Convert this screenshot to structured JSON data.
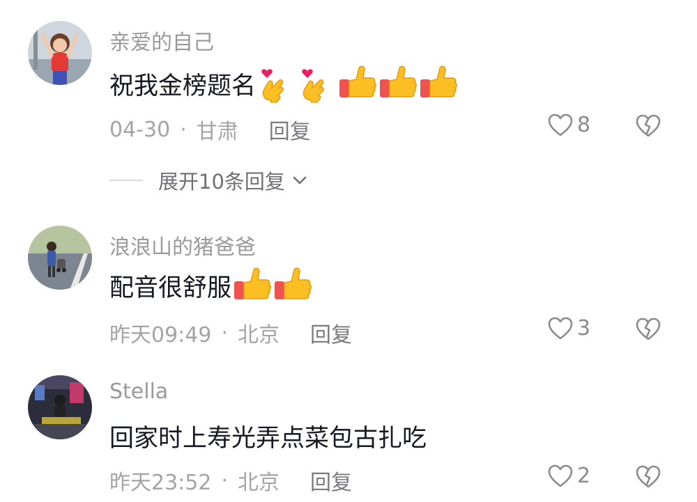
{
  "comments": [
    {
      "username": "亲爱的自己",
      "text": "祝我金榜题名",
      "emojis": [
        "finger-heart",
        "finger-heart",
        "thumbs-up",
        "thumbs-up",
        "thumbs-up"
      ],
      "date": "04-30",
      "separator": "·",
      "location": "甘肃",
      "reply_label": "回复",
      "likes": "8"
    },
    {
      "username": "浪浪山的猪爸爸",
      "text": "配音很舒服",
      "emojis": [
        "thumbs-up",
        "thumbs-up"
      ],
      "date": "昨天09:49",
      "separator": "·",
      "location": "北京",
      "reply_label": "回复",
      "likes": "3"
    },
    {
      "username": "Stella",
      "text": "回家时上寿光弄点菜包古扎吃",
      "emojis": [],
      "date": "昨天23:52",
      "separator": "·",
      "location": "北京",
      "reply_label": "回复",
      "likes": "2"
    }
  ],
  "expand_replies": {
    "label": "展开10条回复"
  },
  "colors": {
    "username": "#9a9a9e",
    "text": "#161823",
    "meta": "#a3a3a8",
    "emoji_yellow": "#fbbf24",
    "emoji_sleeve": "#ef5350",
    "heart_pink": "#e91e63"
  }
}
